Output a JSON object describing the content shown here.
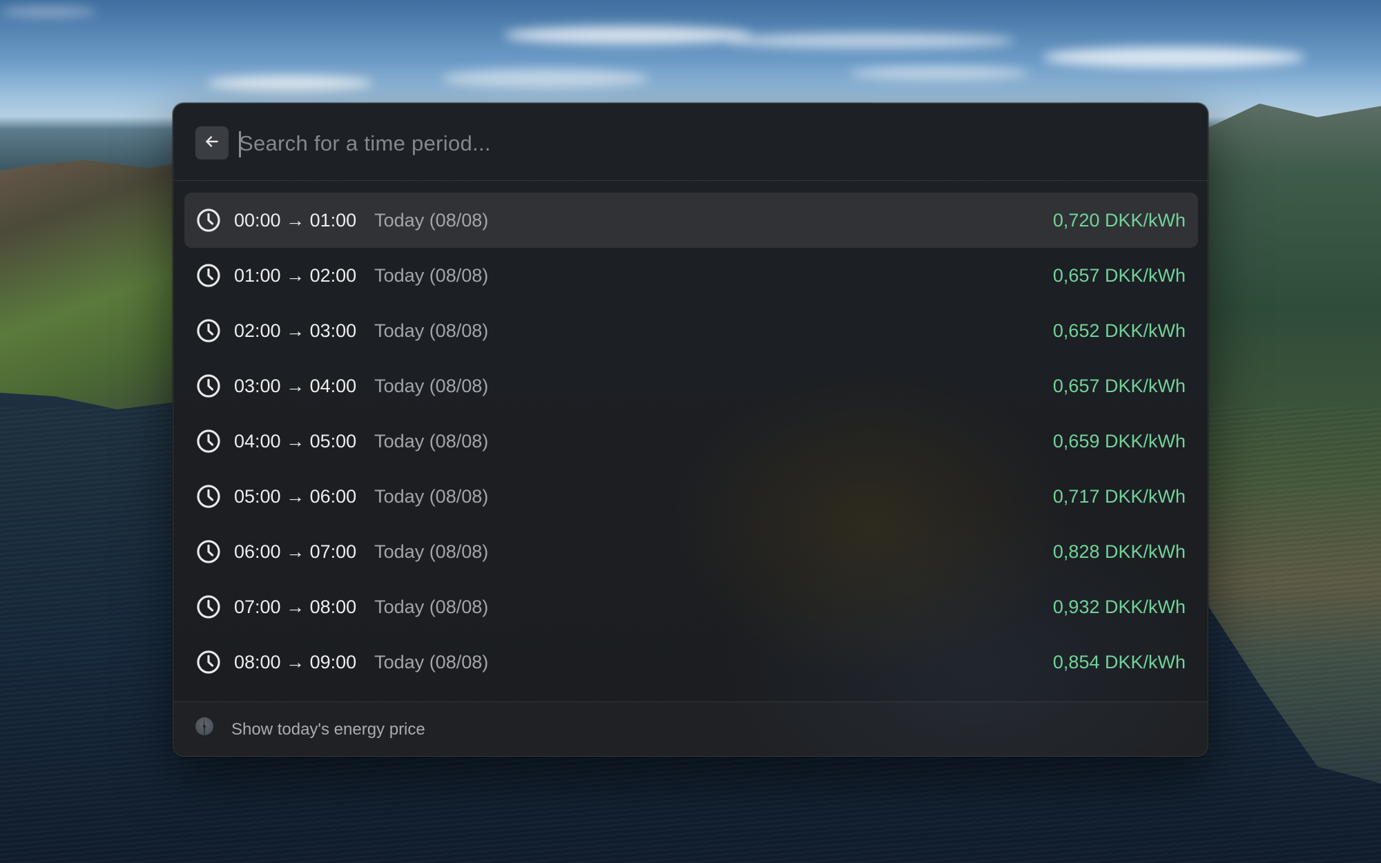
{
  "search": {
    "placeholder": "Search for a time period...",
    "value": ""
  },
  "rows": [
    {
      "time": "00:00 → 01:00",
      "date": "Today (08/08)",
      "price": "0,720 DKK/kWh",
      "selected": true
    },
    {
      "time": "01:00 → 02:00",
      "date": "Today (08/08)",
      "price": "0,657 DKK/kWh",
      "selected": false
    },
    {
      "time": "02:00 → 03:00",
      "date": "Today (08/08)",
      "price": "0,652 DKK/kWh",
      "selected": false
    },
    {
      "time": "03:00 → 04:00",
      "date": "Today (08/08)",
      "price": "0,657 DKK/kWh",
      "selected": false
    },
    {
      "time": "04:00 → 05:00",
      "date": "Today (08/08)",
      "price": "0,659 DKK/kWh",
      "selected": false
    },
    {
      "time": "05:00 → 06:00",
      "date": "Today (08/08)",
      "price": "0,717 DKK/kWh",
      "selected": false
    },
    {
      "time": "06:00 → 07:00",
      "date": "Today (08/08)",
      "price": "0,828 DKK/kWh",
      "selected": false
    },
    {
      "time": "07:00 → 08:00",
      "date": "Today (08/08)",
      "price": "0,932 DKK/kWh",
      "selected": false
    },
    {
      "time": "08:00 → 09:00",
      "date": "Today (08/08)",
      "price": "0,854 DKK/kWh",
      "selected": false
    }
  ],
  "footer": {
    "label": "Show today's energy price",
    "icon": "wind-turbine-icon"
  },
  "icons": {
    "back": "arrow-left-icon",
    "row": "clock-icon"
  },
  "colors": {
    "price": "#72d39a",
    "window_bg": "#1c1e22",
    "selected_row": "rgba(255,255,255,0.085)"
  }
}
